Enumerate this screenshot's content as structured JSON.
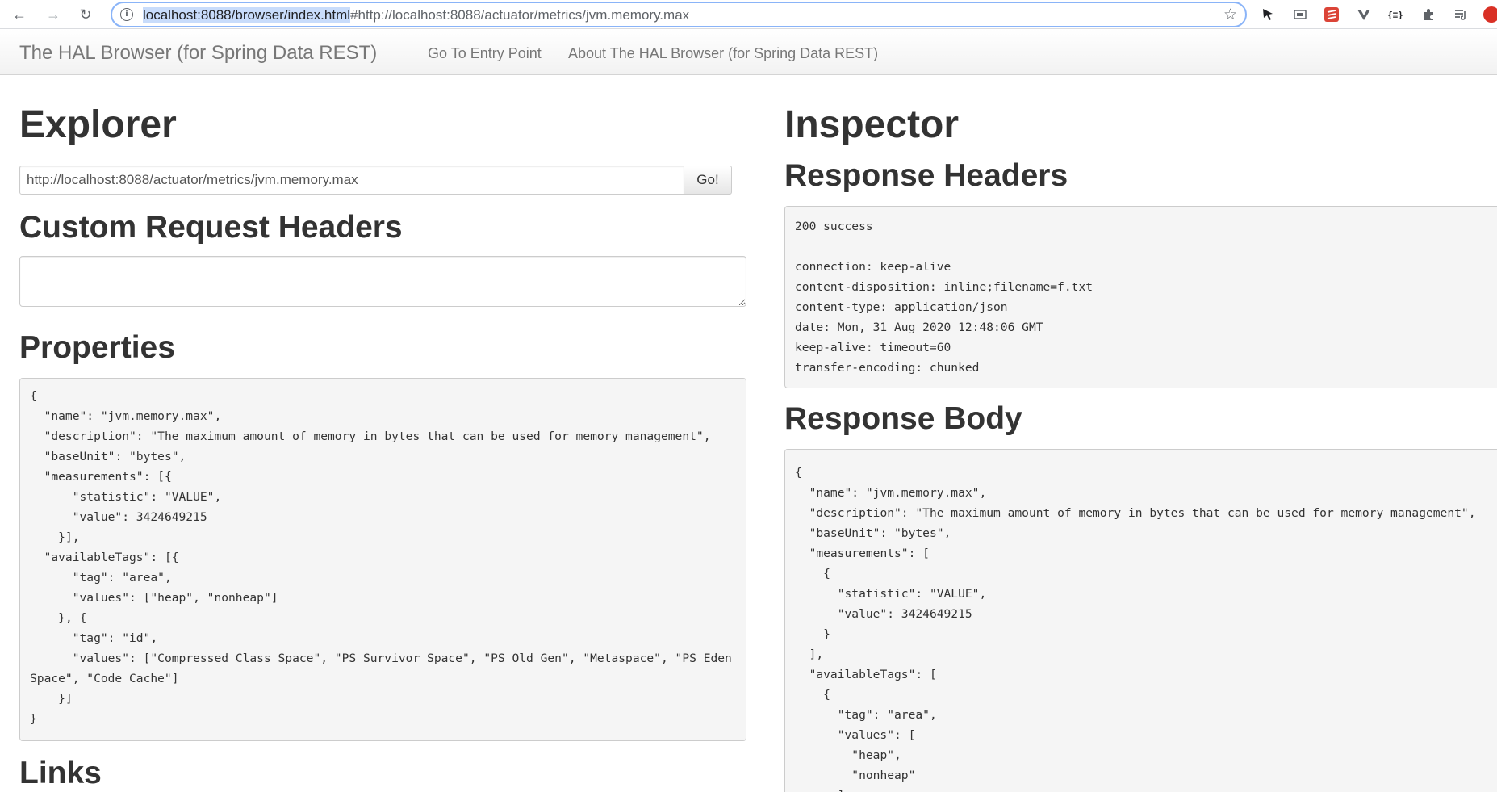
{
  "browser": {
    "url_highlighted": "localhost:8088/browser/index.html",
    "url_fragment": "#http://localhost:8088/actuator/metrics/jvm.memory.max",
    "info_icon": "info-icon",
    "star_icon": "star-icon",
    "extensions": [
      "cursor-extension-icon",
      "screen-extension-icon",
      "stack-extension-icon",
      "vue-extension-icon",
      "json-extension-icon",
      "puzzle-extension-icon",
      "media-queue-icon",
      "profile-avatar"
    ]
  },
  "navbar": {
    "brand": "The HAL Browser (for Spring Data REST)",
    "links": [
      "Go To Entry Point",
      "About The HAL Browser (for Spring Data REST)"
    ]
  },
  "explorer": {
    "title": "Explorer",
    "url_value": "http://localhost:8088/actuator/metrics/jvm.memory.max",
    "go_label": "Go!",
    "custom_headers_title": "Custom Request Headers",
    "custom_headers_value": "",
    "properties_title": "Properties",
    "properties_json": "{\n  \"name\": \"jvm.memory.max\",\n  \"description\": \"The maximum amount of memory in bytes that can be used for memory management\",\n  \"baseUnit\": \"bytes\",\n  \"measurements\": [{\n      \"statistic\": \"VALUE\",\n      \"value\": 3424649215\n    }],\n  \"availableTags\": [{\n      \"tag\": \"area\",\n      \"values\": [\"heap\", \"nonheap\"]\n    }, {\n      \"tag\": \"id\",\n      \"values\": [\"Compressed Class Space\", \"PS Survivor Space\", \"PS Old Gen\", \"Metaspace\", \"PS Eden Space\", \"Code Cache\"]\n    }]\n}",
    "links_title": "Links"
  },
  "inspector": {
    "title": "Inspector",
    "response_headers_title": "Response Headers",
    "response_headers_text": "200 success\n\nconnection: keep-alive\ncontent-disposition: inline;filename=f.txt\ncontent-type: application/json\ndate: Mon, 31 Aug 2020 12:48:06 GMT\nkeep-alive: timeout=60\ntransfer-encoding: chunked",
    "response_body_title": "Response Body",
    "response_body_text": "{\n  \"name\": \"jvm.memory.max\",\n  \"description\": \"The maximum amount of memory in bytes that can be used for memory management\",\n  \"baseUnit\": \"bytes\",\n  \"measurements\": [\n    {\n      \"statistic\": \"VALUE\",\n      \"value\": 3424649215\n    }\n  ],\n  \"availableTags\": [\n    {\n      \"tag\": \"area\",\n      \"values\": [\n        \"heap\",\n        \"nonheap\"\n      ]"
  }
}
